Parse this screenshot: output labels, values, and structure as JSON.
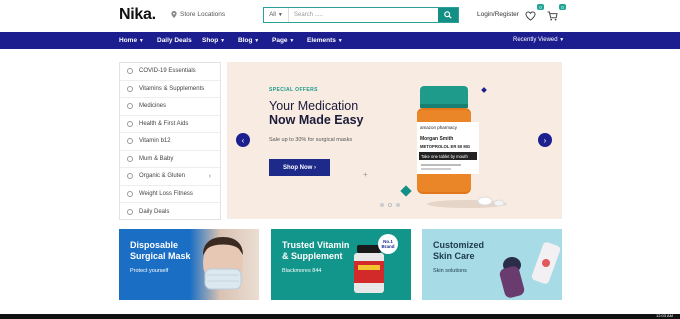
{
  "header": {
    "logo": "Nika.",
    "store_locations": "Store Locations",
    "search": {
      "category": "All",
      "placeholder": "Search ....."
    },
    "login": "Login/Register",
    "wishlist_count": "0",
    "cart_count": "0"
  },
  "nav": {
    "items": [
      "Home",
      "Daily Deals",
      "Shop",
      "Blog",
      "Page",
      "Elements"
    ],
    "recently_viewed": "Recently Viewed"
  },
  "sidebar": {
    "categories": [
      "COVID-19 Essentials",
      "Vitamins & Supplements",
      "Medicines",
      "Health & First Aids",
      "Vitamin b12",
      "Mum & Baby",
      "Organic & Gluten",
      "Weight Loss Fitness",
      "Daily Deals"
    ]
  },
  "hero": {
    "tag": "SPECIAL OFFERS",
    "title_line1": "Your Medication",
    "title_line2": "Now Made Easy",
    "subtitle": "Sale up to 30% for surgical masks",
    "button": "Shop Now",
    "bottle": {
      "brand": "amazon pharmacy",
      "name": "Morgan Smith",
      "drug": "METOPROLOL ER 50 MG",
      "instruction": "Take one tablet by mouth"
    }
  },
  "promos": [
    {
      "title_line1": "Disposable",
      "title_line2": "Surgical Mask",
      "subtitle": "Protect yourself",
      "color": "#1a6fc4"
    },
    {
      "title_line1": "Trusted Vitamin",
      "title_line2": "& Supplement",
      "subtitle": "Blackmores 844",
      "badge": "No.1 Brand",
      "color": "#12958a"
    },
    {
      "title_line1": "Customized",
      "title_line2": "Skin Care",
      "subtitle": "Skin solutions",
      "color": "#a7dbe5"
    }
  ],
  "taskbar": {
    "time": "12:03 AM"
  }
}
